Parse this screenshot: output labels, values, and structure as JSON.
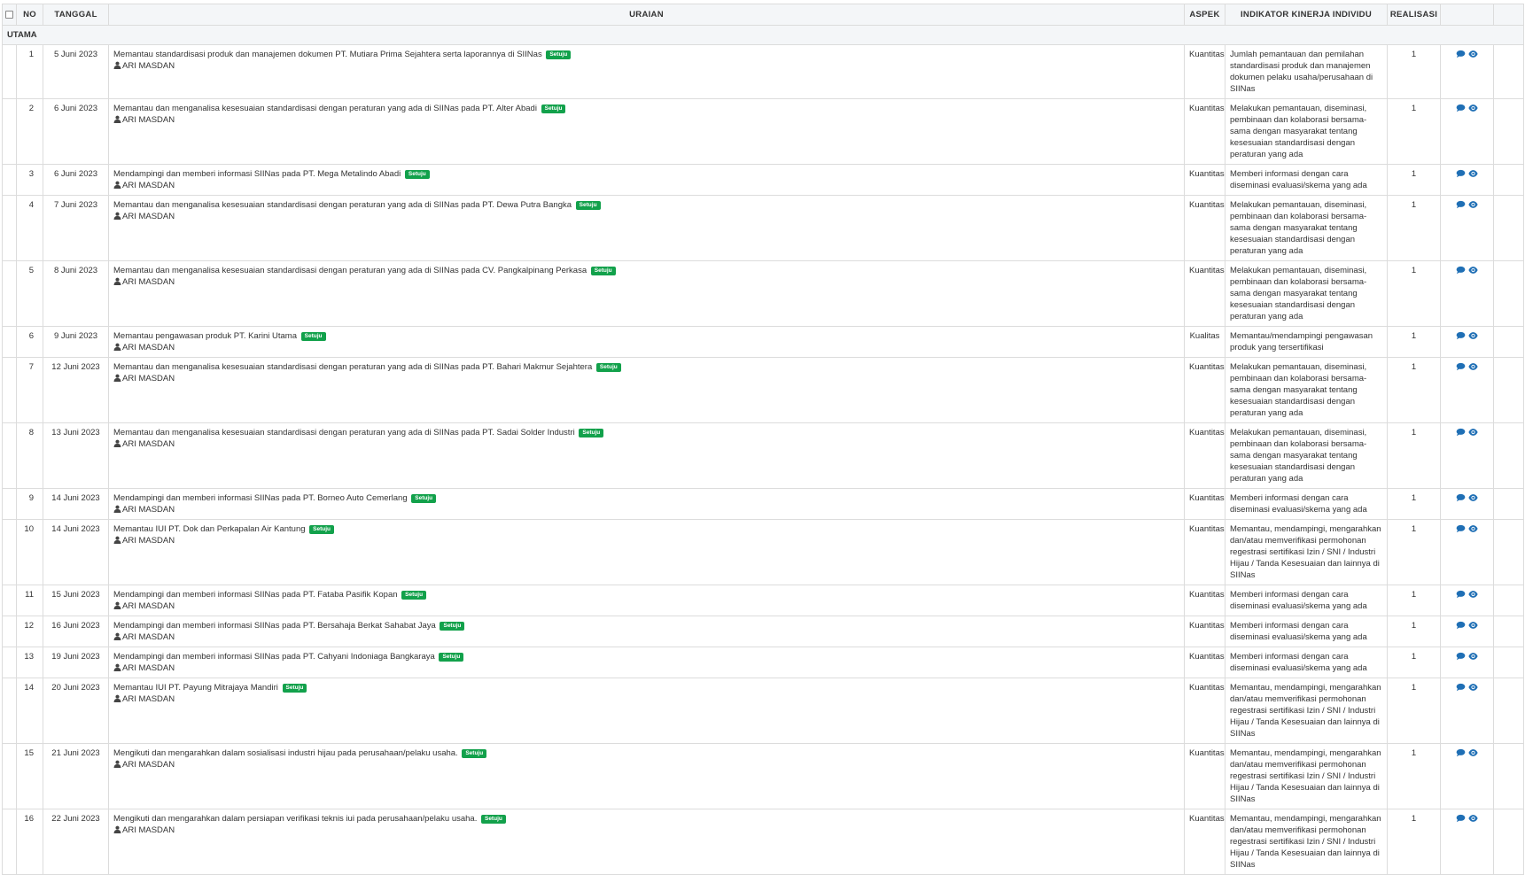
{
  "columns": {
    "no": "NO",
    "tanggal": "TANGGAL",
    "uraian": "URAIAN",
    "aspek": "ASPEK",
    "indikator": "INDIKATOR KINERJA INDIVIDU",
    "realisasi": "REALISASI"
  },
  "section_label": "UTAMA",
  "colors": {
    "badge": "#12a14b",
    "icon": "#1f6fb5",
    "header_bg": "#f4f6f8"
  },
  "icons": [
    "checkbox-icon",
    "user-icon",
    "comment-icon",
    "eye-icon"
  ],
  "rows": [
    {
      "no": "1",
      "tanggal": "5 Juni 2023",
      "uraian": "Memantau standardisasi produk dan manajemen dokumen PT. Mutiara Prima Sejahtera serta laporannya di SIINas",
      "status": "Setuju",
      "person": "ARI MASDAN",
      "aspek": "Kuantitas",
      "indikator": "Jumlah pemantauan dan pemilahan standardisasi produk dan manajemen dokumen pelaku usaha/perusahaan di SIINas",
      "realisasi": "1"
    },
    {
      "no": "2",
      "tanggal": "6 Juni 2023",
      "uraian": "Memantau dan menganalisa kesesuaian standardisasi dengan peraturan yang ada di SIINas pada PT. Alter Abadi",
      "status": "Setuju",
      "person": "ARI MASDAN",
      "aspek": "Kuantitas",
      "indikator": "Melakukan pemantauan, diseminasi, pembinaan dan kolaborasi bersama-sama dengan masyarakat tentang kesesuaian standardisasi dengan peraturan yang ada",
      "realisasi": "1"
    },
    {
      "no": "3",
      "tanggal": "6 Juni 2023",
      "uraian": "Mendampingi dan memberi informasi SIINas pada PT. Mega Metalindo Abadi",
      "status": "Setuju",
      "person": "ARI MASDAN",
      "aspek": "Kuantitas",
      "indikator": "Memberi informasi dengan cara diseminasi evaluasi/skema yang ada",
      "realisasi": "1"
    },
    {
      "no": "4",
      "tanggal": "7 Juni 2023",
      "uraian": "Memantau dan menganalisa kesesuaian standardisasi dengan peraturan yang ada di SIINas pada PT. Dewa Putra Bangka",
      "status": "Setuju",
      "person": "ARI MASDAN",
      "aspek": "Kuantitas",
      "indikator": "Melakukan pemantauan, diseminasi, pembinaan dan kolaborasi bersama-sama dengan masyarakat tentang kesesuaian standardisasi dengan peraturan yang ada",
      "realisasi": "1"
    },
    {
      "no": "5",
      "tanggal": "8 Juni 2023",
      "uraian": "Memantau dan menganalisa kesesuaian standardisasi dengan peraturan yang ada di SIINas pada CV. Pangkalpinang Perkasa",
      "status": "Setuju",
      "person": "ARI MASDAN",
      "aspek": "Kuantitas",
      "indikator": "Melakukan pemantauan, diseminasi, pembinaan dan kolaborasi bersama-sama dengan masyarakat tentang kesesuaian standardisasi dengan peraturan yang ada",
      "realisasi": "1"
    },
    {
      "no": "6",
      "tanggal": "9 Juni 2023",
      "uraian": "Memantau pengawasan produk PT. Karini Utama",
      "status": "Setuju",
      "person": "ARI MASDAN",
      "aspek": "Kualitas",
      "indikator": "Memantau/mendampingi pengawasan produk yang tersertifikasi",
      "realisasi": "1"
    },
    {
      "no": "7",
      "tanggal": "12 Juni 2023",
      "uraian": "Memantau dan menganalisa kesesuaian standardisasi dengan peraturan yang ada di SIINas pada PT. Bahari Makmur Sejahtera",
      "status": "Setuju",
      "person": "ARI MASDAN",
      "aspek": "Kuantitas",
      "indikator": "Melakukan pemantauan, diseminasi, pembinaan dan kolaborasi bersama-sama dengan masyarakat tentang kesesuaian standardisasi dengan peraturan yang ada",
      "realisasi": "1"
    },
    {
      "no": "8",
      "tanggal": "13 Juni 2023",
      "uraian": "Memantau dan menganalisa kesesuaian standardisasi dengan peraturan yang ada di SIINas pada PT. Sadai Solder Industri",
      "status": "Setuju",
      "person": "ARI MASDAN",
      "aspek": "Kuantitas",
      "indikator": "Melakukan pemantauan, diseminasi, pembinaan dan kolaborasi bersama-sama dengan masyarakat tentang kesesuaian standardisasi dengan peraturan yang ada",
      "realisasi": "1"
    },
    {
      "no": "9",
      "tanggal": "14 Juni 2023",
      "uraian": "Mendampingi dan memberi informasi SIINas pada PT. Borneo Auto Cemerlang",
      "status": "Setuju",
      "person": "ARI MASDAN",
      "aspek": "Kuantitas",
      "indikator": "Memberi informasi dengan cara diseminasi evaluasi/skema yang ada",
      "realisasi": "1"
    },
    {
      "no": "10",
      "tanggal": "14 Juni 2023",
      "uraian": "Memantau IUI PT. Dok dan Perkapalan Air Kantung",
      "status": "Setuju",
      "person": "ARI MASDAN",
      "aspek": "Kuantitas",
      "indikator": "Memantau, mendampingi, mengarahkan dan/atau memverifikasi permohonan regestrasi sertifikasi Izin / SNI / Industri Hijau / Tanda Kesesuaian dan lainnya di SIINas",
      "realisasi": "1"
    },
    {
      "no": "11",
      "tanggal": "15 Juni 2023",
      "uraian": "Mendampingi dan memberi informasi SIINas pada PT. Fataba Pasifik Kopan",
      "status": "Setuju",
      "person": "ARI MASDAN",
      "aspek": "Kuantitas",
      "indikator": "Memberi informasi dengan cara diseminasi evaluasi/skema yang ada",
      "realisasi": "1"
    },
    {
      "no": "12",
      "tanggal": "16 Juni 2023",
      "uraian": "Mendampingi dan memberi informasi SIINas pada PT. Bersahaja Berkat Sahabat Jaya",
      "status": "Setuju",
      "person": "ARI MASDAN",
      "aspek": "Kuantitas",
      "indikator": "Memberi informasi dengan cara diseminasi evaluasi/skema yang ada",
      "realisasi": "1"
    },
    {
      "no": "13",
      "tanggal": "19 Juni 2023",
      "uraian": "Mendampingi dan memberi informasi SIINas pada PT. Cahyani Indoniaga Bangkaraya",
      "status": "Setuju",
      "person": "ARI MASDAN",
      "aspek": "Kuantitas",
      "indikator": "Memberi informasi dengan cara diseminasi evaluasi/skema yang ada",
      "realisasi": "1"
    },
    {
      "no": "14",
      "tanggal": "20 Juni 2023",
      "uraian": "Memantau IUI PT. Payung Mitrajaya Mandiri",
      "status": "Setuju",
      "person": "ARI MASDAN",
      "aspek": "Kuantitas",
      "indikator": "Memantau, mendampingi, mengarahkan dan/atau memverifikasi permohonan regestrasi sertifikasi Izin / SNI / Industri Hijau / Tanda Kesesuaian dan lainnya di SIINas",
      "realisasi": "1"
    },
    {
      "no": "15",
      "tanggal": "21 Juni 2023",
      "uraian": "Mengikuti dan mengarahkan dalam sosialisasi industri hijau pada perusahaan/pelaku usaha.",
      "status": "Setuju",
      "person": "ARI MASDAN",
      "aspek": "Kuantitas",
      "indikator": "Memantau, mendampingi, mengarahkan dan/atau memverifikasi permohonan regestrasi sertifikasi Izin / SNI / Industri Hijau / Tanda Kesesuaian dan lainnya di SIINas",
      "realisasi": "1"
    },
    {
      "no": "16",
      "tanggal": "22 Juni 2023",
      "uraian": "Mengikuti dan mengarahkan dalam persiapan verifikasi teknis iui pada perusahaan/pelaku usaha.",
      "status": "Setuju",
      "person": "ARI MASDAN",
      "aspek": "Kuantitas",
      "indikator": "Memantau, mendampingi, mengarahkan dan/atau memverifikasi permohonan regestrasi sertifikasi Izin / SNI / Industri Hijau / Tanda Kesesuaian dan lainnya di SIINas",
      "realisasi": "1"
    }
  ]
}
